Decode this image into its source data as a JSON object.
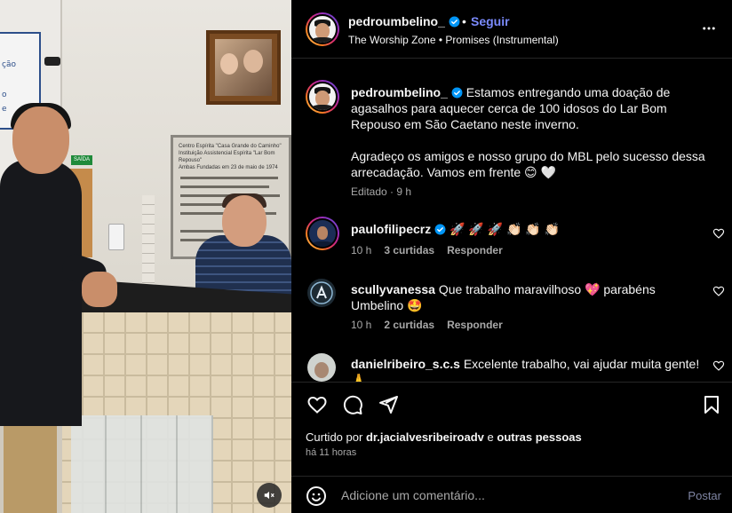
{
  "header": {
    "username": "pedroumbelino_",
    "separator": "•",
    "follow_label": "Seguir",
    "audio": "The Worship Zone • Promises (Instrumental)",
    "more_icon": "more-horizontal-icon"
  },
  "caption": {
    "username": "pedroumbelino_",
    "paragraph1": "Estamos entregando uma doação de agasalhos para aquecer cerca de 100 idosos do Lar Bom Repouso em São Caetano neste inverno.",
    "paragraph2": "Agradeço os amigos e nosso grupo do MBL pelo sucesso dessa arrecadação. Vamos em frente 😊 🤍",
    "edited": "Editado · 9 h"
  },
  "comments": [
    {
      "username": "paulofilipecrz",
      "verified": true,
      "text": "🚀 🚀 🚀 👏🏻 👏🏻 👏🏻",
      "time": "10 h",
      "likes": "3 curtidas",
      "reply": "Responder"
    },
    {
      "username": "scullyvanessa",
      "verified": false,
      "text": "Que trabalho maravilhoso 💖 parabéns Umbelino 🤩",
      "time": "10 h",
      "likes": "2 curtidas",
      "reply": "Responder"
    },
    {
      "username": "danielribeiro_s.c.s",
      "verified": false,
      "text": "Excelente trabalho, vai ajudar muita gente! 🙏",
      "time": "",
      "likes": "",
      "reply": ""
    }
  ],
  "actions": {
    "like_icon": "heart-icon",
    "comment_icon": "comment-icon",
    "share_icon": "share-icon",
    "save_icon": "bookmark-icon"
  },
  "likes": {
    "prefix": "Curtido por",
    "user": "dr.jacialvesribeiroadv",
    "connector": "e",
    "others": "outras pessoas"
  },
  "timestamp": "há 11 horas",
  "add_comment": {
    "placeholder": "Adicione um comentário...",
    "post_label": "Postar",
    "emoji_icon": "emoji-icon"
  },
  "media": {
    "mute_icon": "speaker-muted-icon",
    "wall_sign_text": [
      "ção",
      "o",
      "e"
    ],
    "exit_sign": "SAÍDA",
    "plaque_lines": [
      "Centro Espírita \"Casa Grande do Caminho\"",
      "Instituição Assistencial Espírita \"Lar Bom Repouso\"",
      "Ambas Fundadas em 23 de maio de 1974"
    ]
  },
  "colors": {
    "background": "#000000",
    "text": "#f5f5f5",
    "muted": "#a8a8a8",
    "follow_blue": "#7b8bff",
    "verified_blue": "#0095f6",
    "divider": "#262626"
  }
}
